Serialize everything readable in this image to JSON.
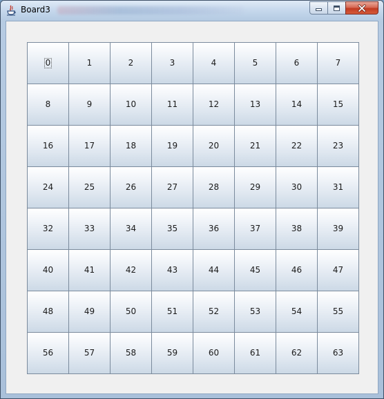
{
  "window": {
    "title": "Board3",
    "controls": {
      "minimize": "minimize-icon",
      "maximize": "maximize-icon",
      "close": "close-icon"
    }
  },
  "board": {
    "focused_index": 0,
    "cells": [
      "0",
      "1",
      "2",
      "3",
      "4",
      "5",
      "6",
      "7",
      "8",
      "9",
      "10",
      "11",
      "12",
      "13",
      "14",
      "15",
      "16",
      "17",
      "18",
      "19",
      "20",
      "21",
      "22",
      "23",
      "24",
      "25",
      "26",
      "27",
      "28",
      "29",
      "30",
      "31",
      "32",
      "33",
      "34",
      "35",
      "36",
      "37",
      "38",
      "39",
      "40",
      "41",
      "42",
      "43",
      "44",
      "45",
      "46",
      "47",
      "48",
      "49",
      "50",
      "51",
      "52",
      "53",
      "54",
      "55",
      "56",
      "57",
      "58",
      "59",
      "60",
      "61",
      "62",
      "63"
    ]
  },
  "colors": {
    "client_background": "#f0f0f0",
    "cell_border": "#7a8a9c",
    "close_button": "#c13b22"
  }
}
